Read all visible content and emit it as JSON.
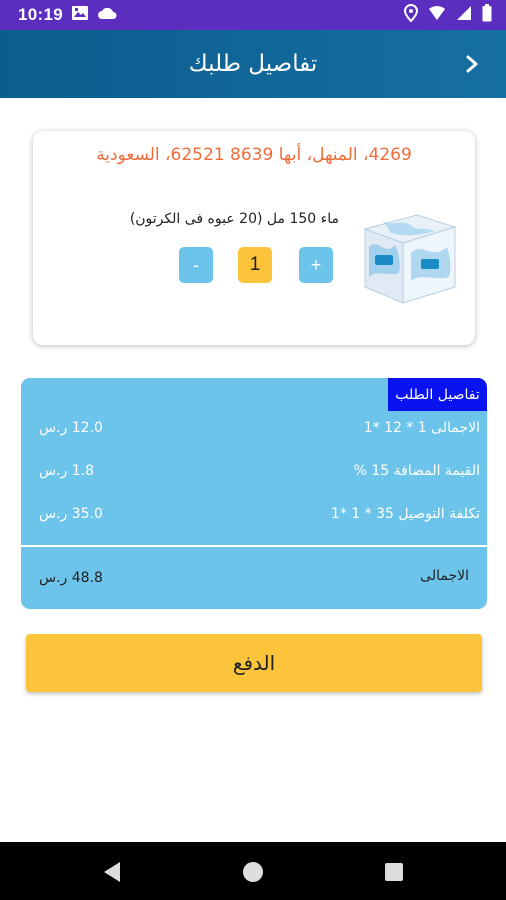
{
  "status_bar": {
    "time": "10:19",
    "left_icons": [
      "image-icon",
      "cloud-icon"
    ],
    "right_icons": [
      "location-icon",
      "wifi-icon",
      "signal-icon",
      "battery-icon"
    ]
  },
  "header": {
    "title": "تفاصيل طلبك",
    "back_icon": "chevron-icon",
    "color": "#0b5d8d"
  },
  "order_item": {
    "address": "4269، المنهل، أبها 8639 62521، السعودية",
    "product_name": "ماء 150 مل (20 عبوه فى الكرتون)",
    "product_image_icon": "water-carton-icon",
    "quantity": "1",
    "plus_label": "+",
    "minus_label": "-"
  },
  "details": {
    "badge": "تفاصيل الطلب",
    "rows": [
      {
        "label": "الاجمالى 1 * 12 *1",
        "value": "12.0 ر.س"
      },
      {
        "label": "القيمة المضافة 15 %",
        "value": "1.8 ر.س"
      },
      {
        "label": "تكلفة التوصيل 35 * 1 *1",
        "value": "35.0 ر.س"
      }
    ],
    "total_label": "الاجمالى",
    "total_value": "48.8 ر.س",
    "background": "#6cc4ea",
    "badge_color": "#0a12f0"
  },
  "pay_button": {
    "label": "الدفع",
    "color": "#fbc43b"
  },
  "nav_bar": {
    "icons": [
      "back-triangle-icon",
      "home-circle-icon",
      "recents-square-icon"
    ]
  }
}
